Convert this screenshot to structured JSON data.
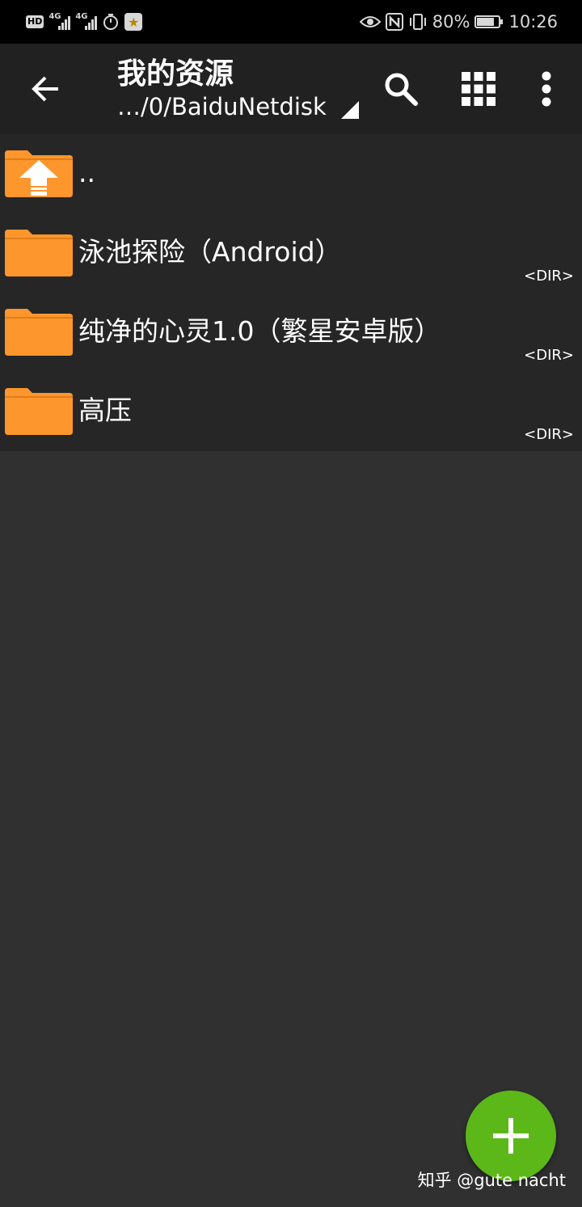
{
  "status_bar": {
    "hd": "HD",
    "network1": "4G",
    "network2": "4G",
    "battery_text": "80%",
    "battery_level": 0.8,
    "time": "10:26",
    "nfc": "N"
  },
  "app_bar": {
    "title": "我的资源",
    "path": "…/0/BaiduNetdisk"
  },
  "files": [
    {
      "name": "..",
      "type": "",
      "icon": "folder-up-icon"
    },
    {
      "name": "泳池探险（Android）",
      "type": "<DIR>",
      "icon": "folder-icon"
    },
    {
      "name": "纯净的心灵1.0（繁星安卓版）",
      "type": "<DIR>",
      "icon": "folder-icon"
    },
    {
      "name": "高压",
      "type": "<DIR>",
      "icon": "folder-icon"
    }
  ],
  "watermark": "知乎 @gute nacht",
  "colors": {
    "folder": "#fd962c",
    "fab": "#5cb818",
    "background": "#303030",
    "toolbar": "#212121",
    "list": "#262626"
  }
}
